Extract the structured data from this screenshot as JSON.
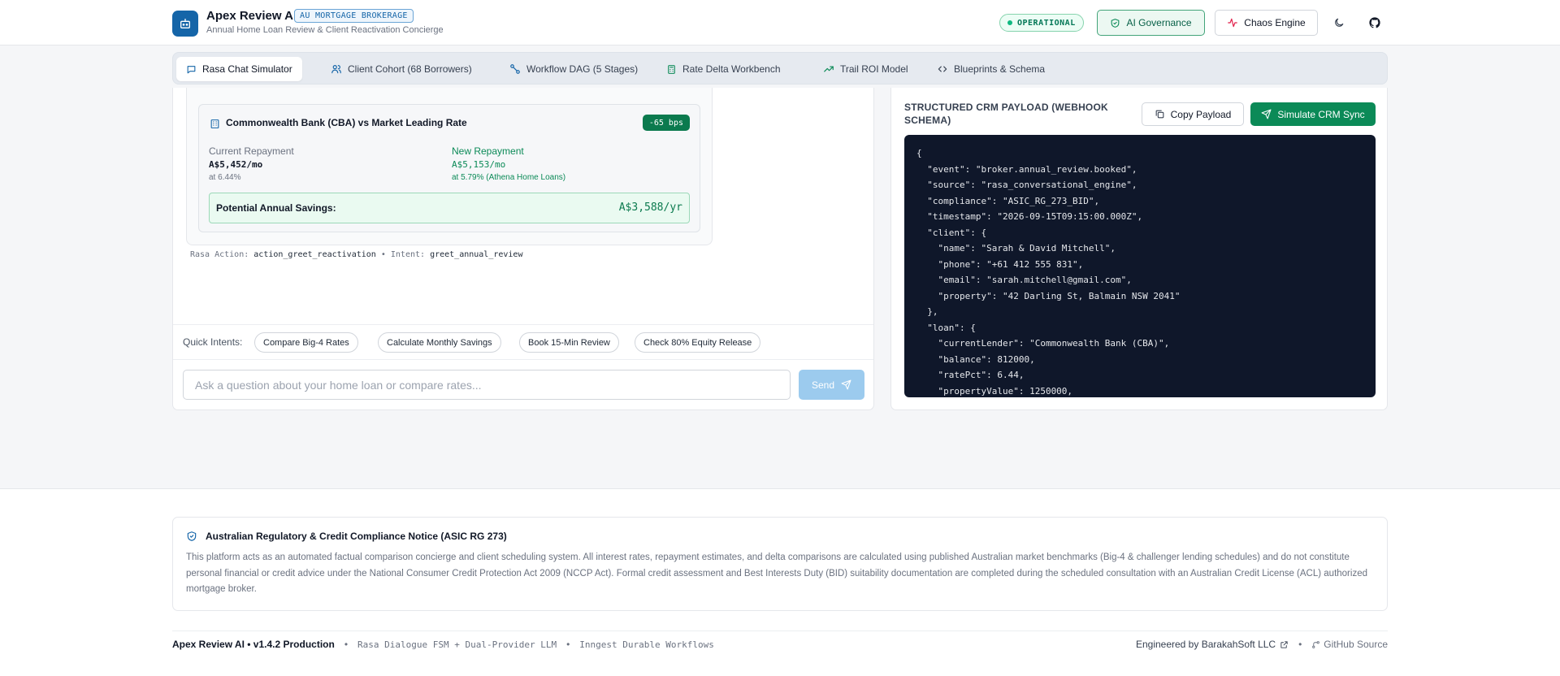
{
  "header": {
    "title": "Apex Review AI",
    "badge": "AU MORTGAGE BROKERAGE",
    "subtitle": "Annual Home Loan Review & Client Reactivation Concierge",
    "status": "OPERATIONAL",
    "governance_label": "AI Governance",
    "chaos_label": "Chaos Engine"
  },
  "tabs": [
    {
      "label": "Rasa Chat Simulator"
    },
    {
      "label": "Client Cohort (68 Borrowers)"
    },
    {
      "label": "Workflow DAG (5 Stages)"
    },
    {
      "label": "Rate Delta Workbench"
    },
    {
      "label": "Trail ROI Model"
    },
    {
      "label": "Blueprints & Schema"
    }
  ],
  "comparison": {
    "title": "Commonwealth Bank (CBA) vs Market Leading Rate",
    "bps": "-65 bps",
    "current_label": "Current Repayment",
    "current_value": "A$5,452/mo",
    "current_rate": "at 6.44%",
    "new_label": "New Repayment",
    "new_value": "A$5,153/mo",
    "new_rate": "at 5.79% (Athena Home Loans)",
    "savings_label": "Potential Annual Savings:",
    "savings_value": "A$3,588/yr"
  },
  "rasa": {
    "action_label": "Rasa Action:",
    "action": "action_greet_reactivation",
    "sep": "•",
    "intent_label": "Intent:",
    "intent": "greet_annual_review"
  },
  "quick_intents": {
    "label": "Quick Intents:",
    "chips": [
      "Compare Big-4 Rates",
      "Calculate Monthly Savings",
      "Book 15-Min Review",
      "Check 80% Equity Release"
    ]
  },
  "chat": {
    "placeholder": "Ask a question about your home loan or compare rates...",
    "send_label": "Send"
  },
  "payload": {
    "title": "STRUCTURED CRM PAYLOAD (WEBHOOK SCHEMA)",
    "copy_label": "Copy Payload",
    "sync_label": "Simulate CRM Sync",
    "code": "{\n  \"event\": \"broker.annual_review.booked\",\n  \"source\": \"rasa_conversational_engine\",\n  \"compliance\": \"ASIC_RG_273_BID\",\n  \"timestamp\": \"2026-09-15T09:15:00.000Z\",\n  \"client\": {\n    \"name\": \"Sarah & David Mitchell\",\n    \"phone\": \"+61 412 555 831\",\n    \"email\": \"sarah.mitchell@gmail.com\",\n    \"property\": \"42 Darling St, Balmain NSW 2041\"\n  },\n  \"loan\": {\n    \"currentLender\": \"Commonwealth Bank (CBA)\",\n    \"balance\": 812000,\n    \"ratePct\": 6.44,\n    \"propertyValue\": 1250000,"
  },
  "notice": {
    "title": "Australian Regulatory & Credit Compliance Notice (ASIC RG 273)",
    "body": "This platform acts as an automated factual comparison concierge and client scheduling system. All interest rates, repayment estimates, and delta comparisons are calculated using published Australian market benchmarks (Big-4 & challenger lending schedules) and do not constitute personal financial or credit advice under the National Consumer Credit Protection Act 2009 (NCCP Act). Formal credit assessment and Best Interests Duty (BID) suitability documentation are completed during the scheduled consultation with an Australian Credit License (ACL) authorized mortgage broker."
  },
  "footer": {
    "version": "Apex Review AI • v1.4.2 Production",
    "sep": "•",
    "tech1": "Rasa Dialogue FSM + Dual-Provider LLM",
    "tech2": "Inngest Durable Workflows",
    "engineered": "Engineered by BarakahSoft LLC",
    "github": "GitHub Source"
  },
  "colors": {
    "brand": "#1565a8",
    "success": "#0b8a57",
    "code_bg": "#0f172a"
  }
}
